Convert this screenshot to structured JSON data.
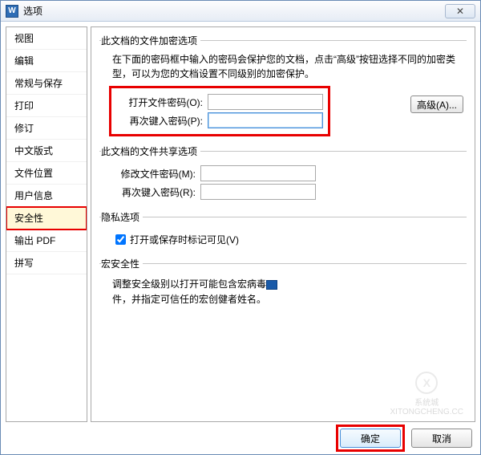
{
  "window": {
    "app_icon_letter": "W",
    "title": "选项",
    "close_glyph": "✕"
  },
  "sidebar": {
    "items": [
      {
        "label": "视图"
      },
      {
        "label": "编辑"
      },
      {
        "label": "常规与保存"
      },
      {
        "label": "打印"
      },
      {
        "label": "修订"
      },
      {
        "label": "中文版式"
      },
      {
        "label": "文件位置"
      },
      {
        "label": "用户信息"
      },
      {
        "label": "安全性",
        "selected": true
      },
      {
        "label": "输出 PDF"
      },
      {
        "label": "拼写"
      }
    ]
  },
  "sections": {
    "encrypt": {
      "legend": "此文档的文件加密选项",
      "desc": "在下面的密码框中输入的密码会保护您的文档，点击“高级”按钮选择不同的加密类型，可以为您的文档设置不同级别的加密保护。",
      "open_pw_label": "打开文件密码(O):",
      "reenter_label": "再次键入密码(P):",
      "advanced_btn": "高级(A)..."
    },
    "share": {
      "legend": "此文档的文件共享选项",
      "modify_pw_label": "修改文件密码(M):",
      "reenter_label": "再次键入密码(R):"
    },
    "privacy": {
      "legend": "隐私选项",
      "chk_label": "打开或保存时标记可见(V)",
      "chk_checked": true
    },
    "macro": {
      "legend": "宏安全性",
      "line1_prefix": "调整安全级别以打开可能包含宏病毒",
      "line2": "件，并指定可信任的宏创健者姓名。"
    }
  },
  "watermark": {
    "brand": "系统城",
    "url": "XITONGCHENG.CC",
    "glyph": "X"
  },
  "footer": {
    "ok": "确定",
    "cancel": "取消"
  }
}
